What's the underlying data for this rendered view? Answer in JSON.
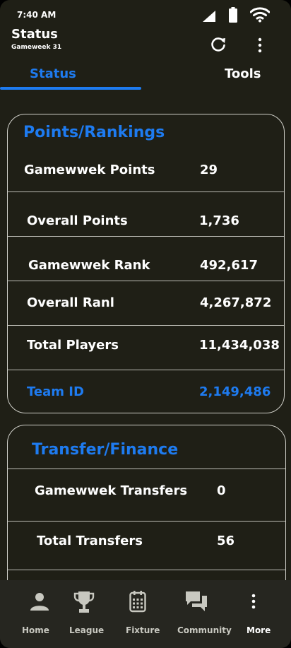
{
  "status_bar": {
    "time": "7:40 AM"
  },
  "header": {
    "title": "Status",
    "subtitle": "Gameweek 31"
  },
  "tabs": [
    {
      "label": "Status"
    },
    {
      "label": "Tools"
    }
  ],
  "points_card": {
    "title": "Points/Rankings",
    "rows": [
      {
        "label": "Gamewwek Points",
        "value": "29"
      },
      {
        "label": "Overall Points",
        "value": "1,736"
      },
      {
        "label": "Gamewwek Rank",
        "value": "492,617"
      },
      {
        "label": "Overall Ranl",
        "value": "4,267,872"
      },
      {
        "label": "Total Players",
        "value": "11,434,038"
      },
      {
        "label": "Team ID",
        "value": "2,149,486"
      }
    ]
  },
  "transfer_card": {
    "title": "Transfer/Finance",
    "rows": [
      {
        "label": "Gamewwek Transfers",
        "value": "0"
      },
      {
        "label": "Total  Transfers",
        "value": "56"
      }
    ]
  },
  "bottom_nav": [
    {
      "label": "Home",
      "icon": "person-icon"
    },
    {
      "label": "League",
      "icon": "trophy-icon"
    },
    {
      "label": "Fixture",
      "icon": "calendar-icon"
    },
    {
      "label": "Community",
      "icon": "chat-icon"
    },
    {
      "label": "More",
      "icon": "more-vert-icon"
    }
  ],
  "colors": {
    "accent": "#1e7bf0",
    "background": "#1f1f16",
    "nav_background": "#262620"
  }
}
